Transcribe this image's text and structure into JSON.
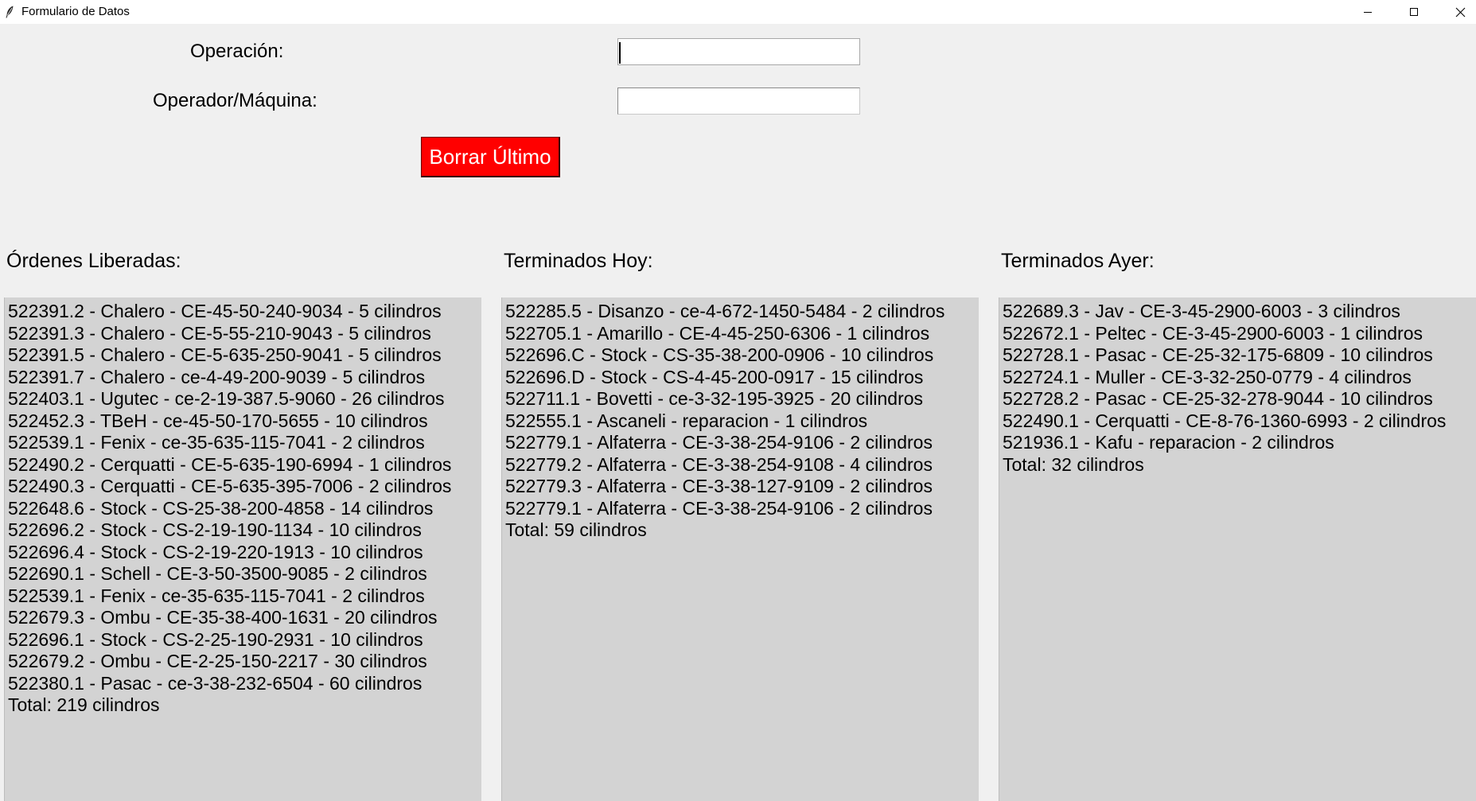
{
  "window": {
    "title": "Formulario de Datos"
  },
  "form": {
    "operacion_label": "Operación:",
    "operacion_value": "",
    "operador_label": "Operador/Máquina:",
    "operador_value": "",
    "delete_button_label": "Borrar Último"
  },
  "colors": {
    "delete_button_bg": "#ff0000",
    "delete_button_text": "#ffffff",
    "listbox_bg": "#d3d3d3",
    "window_bg": "#f0f0f0"
  },
  "lists": {
    "liberadas": {
      "title": "Órdenes Liberadas:",
      "items": [
        "522391.2 - Chalero - CE-45-50-240-9034 - 5 cilindros",
        "522391.3 - Chalero - CE-5-55-210-9043 - 5 cilindros",
        "522391.5 - Chalero - CE-5-635-250-9041 - 5 cilindros",
        "522391.7 - Chalero - ce-4-49-200-9039 - 5 cilindros",
        "522403.1 - Ugutec - ce-2-19-387.5-9060 - 26 cilindros",
        "522452.3 - TBeH - ce-45-50-170-5655 - 10 cilindros",
        "522539.1 - Fenix - ce-35-635-115-7041 - 2 cilindros",
        "522490.2 - Cerquatti - CE-5-635-190-6994 - 1 cilindros",
        "522490.3 - Cerquatti - CE-5-635-395-7006 - 2 cilindros",
        "522648.6 - Stock - CS-25-38-200-4858 - 14 cilindros",
        "522696.2 - Stock - CS-2-19-190-1134 - 10 cilindros",
        "522696.4 - Stock - CS-2-19-220-1913 - 10 cilindros",
        "522690.1 - Schell - CE-3-50-3500-9085 - 2 cilindros",
        "522539.1 - Fenix - ce-35-635-115-7041 - 2 cilindros",
        "522679.3 - Ombu - CE-35-38-400-1631 - 20 cilindros",
        "522696.1 - Stock - CS-2-25-190-2931 - 10 cilindros",
        "522679.2 - Ombu - CE-2-25-150-2217 - 30 cilindros",
        "522380.1 - Pasac - ce-3-38-232-6504 - 60 cilindros",
        "Total: 219 cilindros"
      ]
    },
    "hoy": {
      "title": "Terminados Hoy:",
      "items": [
        "522285.5 - Disanzo - ce-4-672-1450-5484 - 2 cilindros",
        "522705.1 - Amarillo - CE-4-45-250-6306 - 1 cilindros",
        "522696.C - Stock - CS-35-38-200-0906 - 10 cilindros",
        "522696.D - Stock - CS-4-45-200-0917 - 15 cilindros",
        "522711.1 - Bovetti - ce-3-32-195-3925 - 20 cilindros",
        "522555.1 - Ascaneli - reparacion - 1 cilindros",
        "522779.1 - Alfaterra - CE-3-38-254-9106 - 2 cilindros",
        "522779.2 - Alfaterra - CE-3-38-254-9108 - 4 cilindros",
        "522779.3 - Alfaterra - CE-3-38-127-9109 - 2 cilindros",
        "522779.1 - Alfaterra - CE-3-38-254-9106 - 2 cilindros",
        "Total: 59 cilindros"
      ]
    },
    "ayer": {
      "title": "Terminados Ayer:",
      "items": [
        "522689.3 - Jav - CE-3-45-2900-6003 - 3 cilindros",
        "522672.1 - Peltec - CE-3-45-2900-6003 - 1 cilindros",
        "522728.1 - Pasac - CE-25-32-175-6809 - 10 cilindros",
        "522724.1 - Muller - CE-3-32-250-0779 - 4 cilindros",
        "522728.2 - Pasac - CE-25-32-278-9044 - 10 cilindros",
        "522490.1 - Cerquatti - CE-8-76-1360-6993 - 2 cilindros",
        "521936.1 - Kafu - reparacion - 2 cilindros",
        "Total: 32 cilindros"
      ]
    }
  }
}
